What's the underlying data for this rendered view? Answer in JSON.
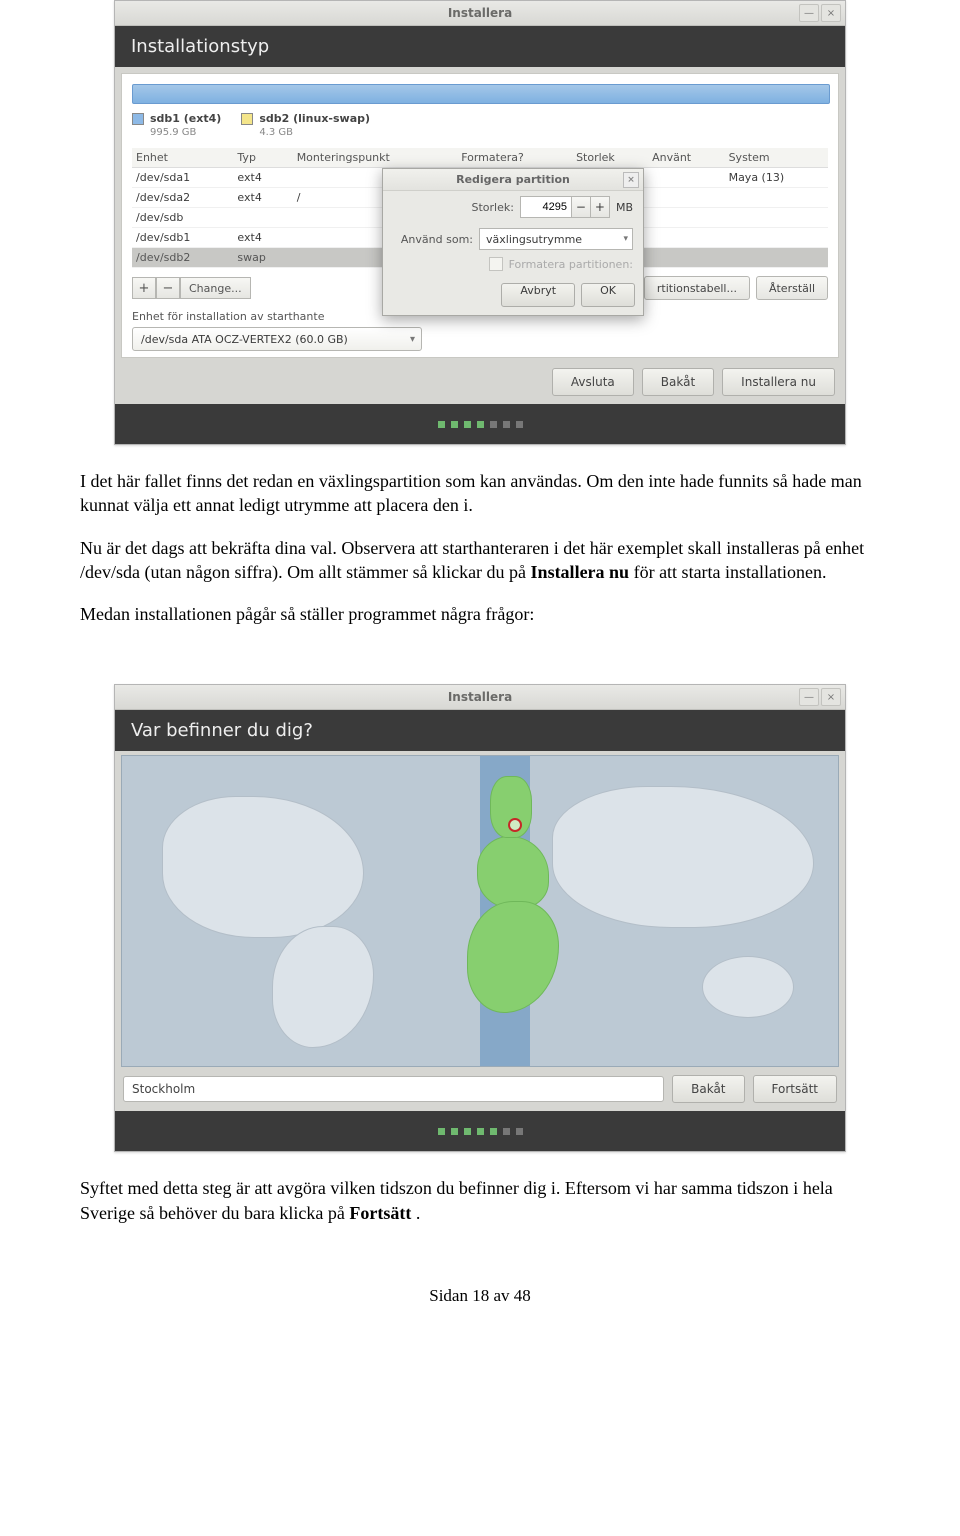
{
  "win1": {
    "title": "Installera",
    "header": "Installationstyp",
    "legend": {
      "a": {
        "label": "sdb1 (ext4)",
        "sub": "995.9 GB"
      },
      "b": {
        "label": "sdb2 (linux-swap)",
        "sub": "4.3 GB"
      }
    },
    "cols": {
      "c0": "Enhet",
      "c1": "Typ",
      "c2": "Monteringspunkt",
      "c3": "Formatera?",
      "c4": "Storlek",
      "c5": "Använt",
      "c6": "System"
    },
    "rows": [
      {
        "dev": "/dev/sda1",
        "typ": "ext4",
        "mnt": "",
        "sys": "Maya (13)"
      },
      {
        "dev": "/dev/sda2",
        "typ": "ext4",
        "mnt": "/",
        "sys": ""
      },
      {
        "dev": "/dev/sdb",
        "typ": "",
        "mnt": "",
        "sys": ""
      },
      {
        "dev": "/dev/sdb1",
        "typ": "ext4",
        "mnt": "",
        "sys": ""
      },
      {
        "dev": "/dev/sdb2",
        "typ": "swap",
        "mnt": "",
        "sys": ""
      }
    ],
    "toolbar": {
      "plus": "+",
      "minus": "−",
      "change": "Change...",
      "parttable": "rtitionstabell...",
      "reset": "Återställ"
    },
    "bootlabel": "Enhet för installation av starthante",
    "bootvalue": "/dev/sda   ATA OCZ-VERTEX2 (60.0 GB)",
    "buttons": {
      "quit": "Avsluta",
      "back": "Bakåt",
      "install": "Installera nu"
    }
  },
  "dialog": {
    "title": "Redigera partition",
    "size_label": "Storlek:",
    "size_value": "4295",
    "unit": "MB",
    "use_label": "Använd som:",
    "use_value": "växlingsutrymme",
    "format_label": "Formatera partitionen:",
    "cancel": "Avbryt",
    "ok": "OK"
  },
  "body": {
    "p1a": "I det här fallet finns det redan en växlingspartition som kan användas. Om den inte hade funnits så hade man kunnat välja ett annat ledigt utrymme att placera den i.",
    "p2a": "Nu är det dags att bekräfta dina val. Observera att starthanteraren i det här exemplet skall installeras på enhet /dev/sda (utan någon siffra). Om allt stämmer så klickar du på ",
    "p2b": "Installera nu",
    "p2c": " för att starta installationen.",
    "p3": "Medan installationen pågår så ställer programmet några frågor:",
    "p4a": "Syftet med detta steg är att avgöra vilken tidszon du befinner dig i. Eftersom vi har samma tidszon i hela Sverige så behöver du bara klicka på ",
    "p4b": "Fortsätt",
    "p4c": ".",
    "footer": "Sidan 18 av 48"
  },
  "win2": {
    "title": "Installera",
    "header": "Var befinner du dig?",
    "city": "Stockholm",
    "back": "Bakåt",
    "cont": "Fortsätt"
  }
}
